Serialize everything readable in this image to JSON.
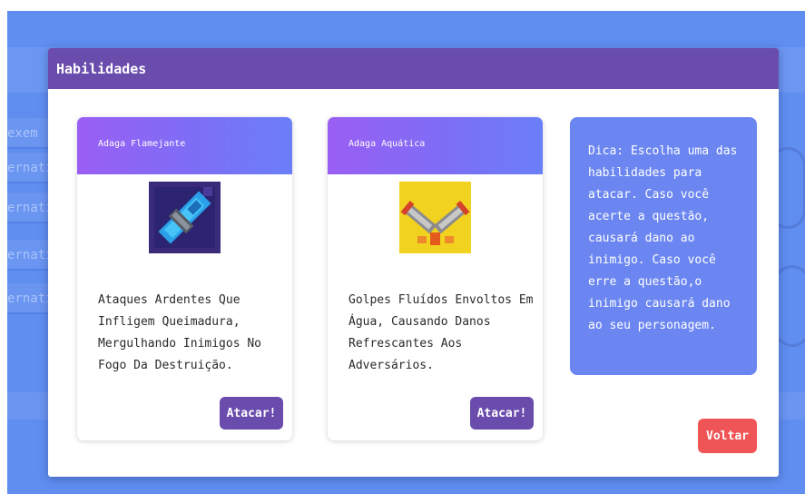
{
  "background": {
    "side_items": [
      "exem",
      "ernati",
      "ernati",
      "ernati",
      "ernati"
    ]
  },
  "modal": {
    "title": "Habilidades",
    "cards": [
      {
        "name": "Adaga Flamejante",
        "description": "Ataques Ardentes Que Infligem Queimadura, Mergulhando Inimigos No Fogo Da Destruição.",
        "button_label": "Atacar!"
      },
      {
        "name": "Adaga Aquática",
        "description": "Golpes Fluídos Envoltos Em Água, Causando Danos Refrescantes Aos Adversários.",
        "button_label": "Atacar!"
      }
    ],
    "tip": "Dica: Escolha uma das habilidades para atacar. Caso você acerte a questão, causará dano ao inimigo. Caso você erre a questão,o inimigo causará dano ao seu personagem.",
    "back_label": "Voltar"
  },
  "colors": {
    "header": "#6a4cad",
    "back_button": "#ef5557",
    "tip_box": "#6b86f0"
  }
}
